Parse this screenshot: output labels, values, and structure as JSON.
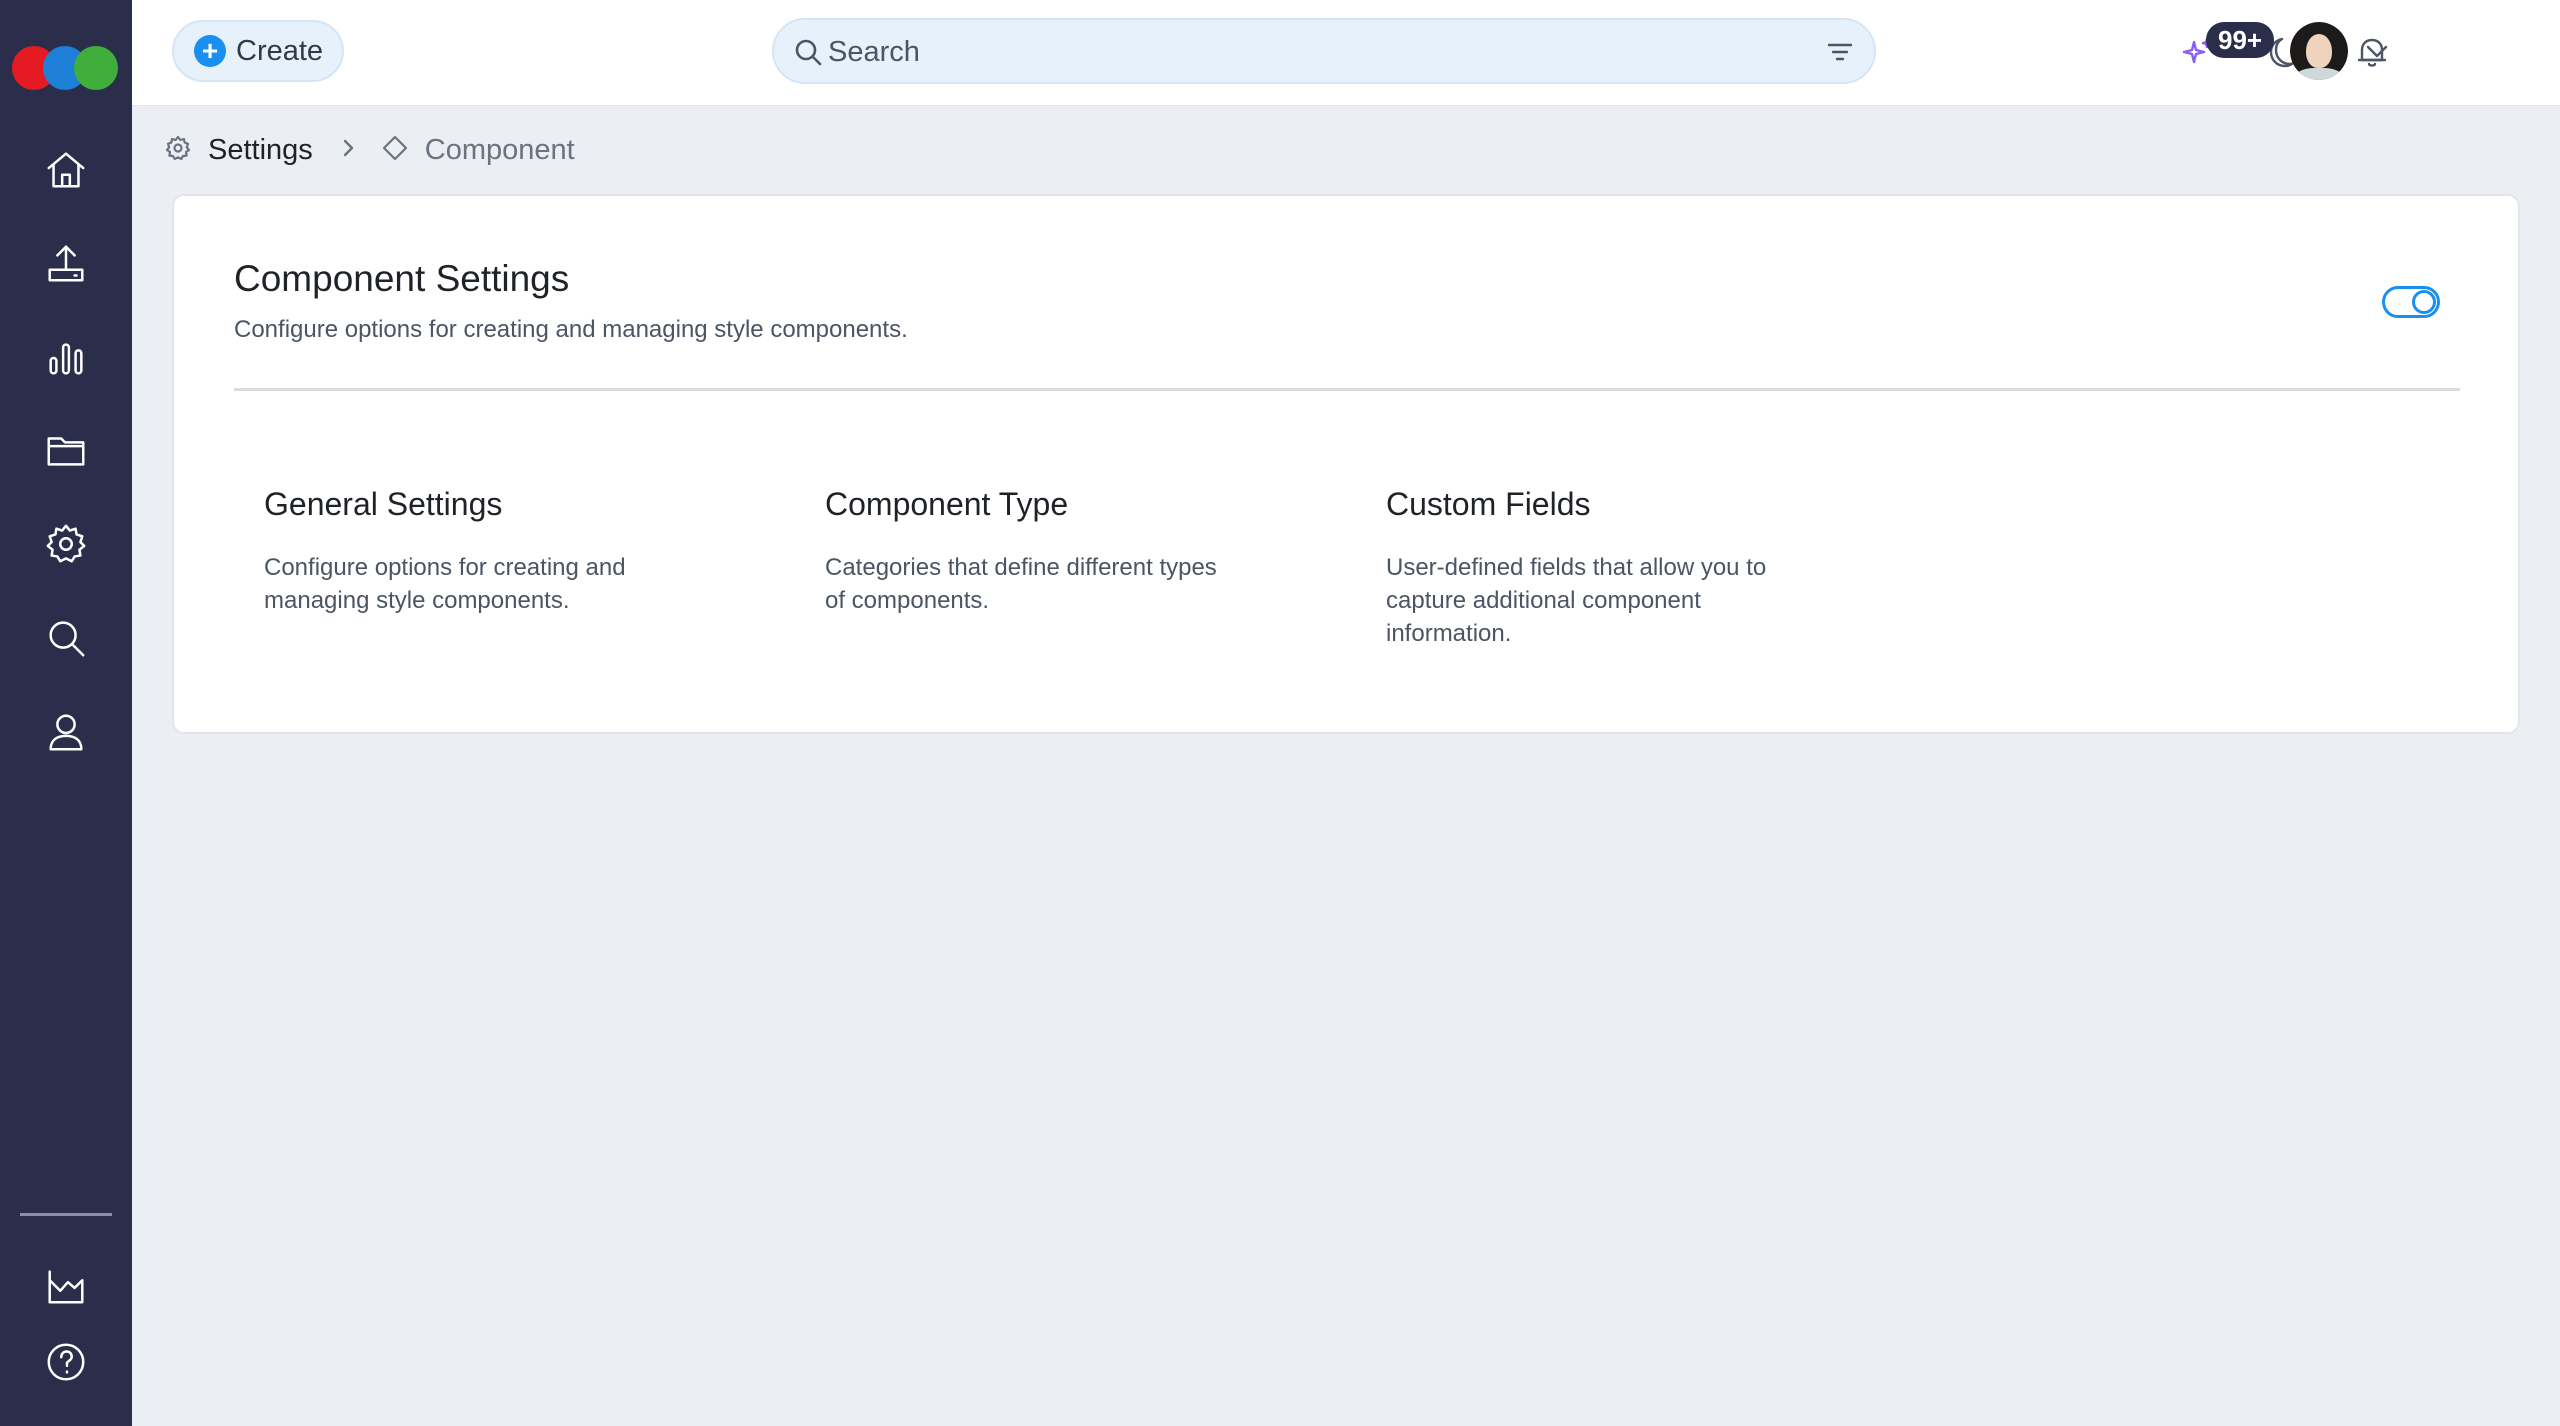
{
  "sidebar": {
    "logo": "app-logo",
    "items": [
      {
        "name": "home",
        "icon": "home-icon"
      },
      {
        "name": "upload",
        "icon": "upload-icon"
      },
      {
        "name": "analytics",
        "icon": "bar-chart-icon"
      },
      {
        "name": "folders",
        "icon": "folder-icon"
      },
      {
        "name": "settings",
        "icon": "gear-icon"
      },
      {
        "name": "search",
        "icon": "search-icon"
      },
      {
        "name": "profile",
        "icon": "user-icon"
      }
    ],
    "bottom_items": [
      {
        "name": "reports",
        "icon": "factory-chart-icon"
      },
      {
        "name": "help",
        "icon": "help-circle-icon"
      }
    ]
  },
  "topbar": {
    "create_label": "Create",
    "search_placeholder": "Search",
    "notifications_badge": "99+",
    "icons": [
      "sparkle-icon",
      "moon-icon",
      "bell-icon",
      "chevron-down-icon"
    ]
  },
  "breadcrumb": {
    "items": [
      {
        "label": "Settings",
        "icon": "gear-icon"
      },
      {
        "label": "Component",
        "icon": "diamond-icon"
      }
    ]
  },
  "card": {
    "title": "Component Settings",
    "description": "Configure options for creating and managing style components.",
    "toggle_on": true,
    "sections": [
      {
        "title": "General Settings",
        "description": "Configure options for creating and managing style components."
      },
      {
        "title": "Component Type",
        "description": "Categories that define different types of components."
      },
      {
        "title": "Custom Fields",
        "description": "User-defined fields that allow you to capture additional component information."
      }
    ]
  },
  "colors": {
    "sidebar_bg": "#2a2e4a",
    "accent": "#1a8ff0",
    "page_bg": "#ebeef3",
    "search_bg": "#e6f1fb"
  }
}
